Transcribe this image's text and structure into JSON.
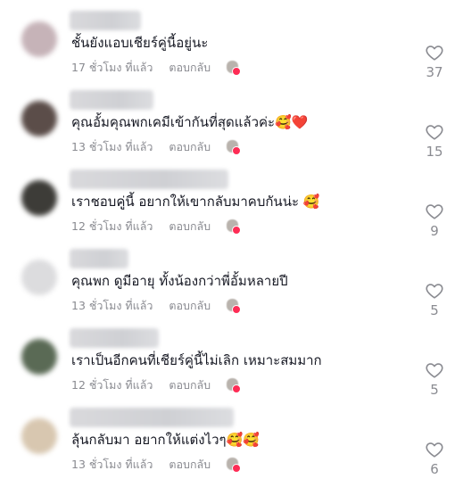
{
  "comments": [
    {
      "text": "ชั้นยังแอบเชียร์คู่นี้อยู่นะ",
      "time": "17 ชั่วโมง ที่แล้ว",
      "reply": "ตอบกลับ",
      "likes": "37",
      "avatar_color": "#c6b3b8",
      "username_width": 80
    },
    {
      "text": "คุณอั้มคุณพกเคมีเข้ากันที่สุดแล้วค่ะ🥰❤️",
      "time": "13 ชั่วโมง ที่แล้ว",
      "reply": "ตอบกลับ",
      "likes": "15",
      "avatar_color": "#5b4d49",
      "username_width": 94
    },
    {
      "text": "เราชอบคู่นี้ อยากให้เขากลับมาคบกันน่ะ 🥰",
      "time": "12 ชั่วโมง ที่แล้ว",
      "reply": "ตอบกลับ",
      "likes": "9",
      "avatar_color": "#3d3c38",
      "username_width": 178
    },
    {
      "text": "คุณพก ดูมีอายุ ทั้งน้องกว่าพี่อั้มหลายปี",
      "time": "13 ชั่วโมง ที่แล้ว",
      "reply": "ตอบกลับ",
      "likes": "5",
      "avatar_color": "#dcdcde",
      "username_width": 66
    },
    {
      "text": "เราเป็นอีกคนที่เชียร์คู่นี้ไม่เลิก เหมาะสมมาก",
      "time": "12 ชั่วโมง ที่แล้ว",
      "reply": "ตอบกลับ",
      "likes": "5",
      "avatar_color": "#5a6a55",
      "username_width": 100
    },
    {
      "text": "ลุ้นกลับมา อยากให้แต่งไวๆ🥰🥰",
      "time": "13 ชั่วโมง ที่แล้ว",
      "reply": "ตอบกลับ",
      "likes": "6",
      "avatar_color": "#d8c7b0",
      "username_width": 184
    }
  ],
  "icons": {
    "like": "heart-outline-icon",
    "creator": "creator-liked-badge-icon"
  },
  "colors": {
    "text": "#161823",
    "meta": "#8a8b91",
    "badge_heart": "#fe2c55"
  }
}
